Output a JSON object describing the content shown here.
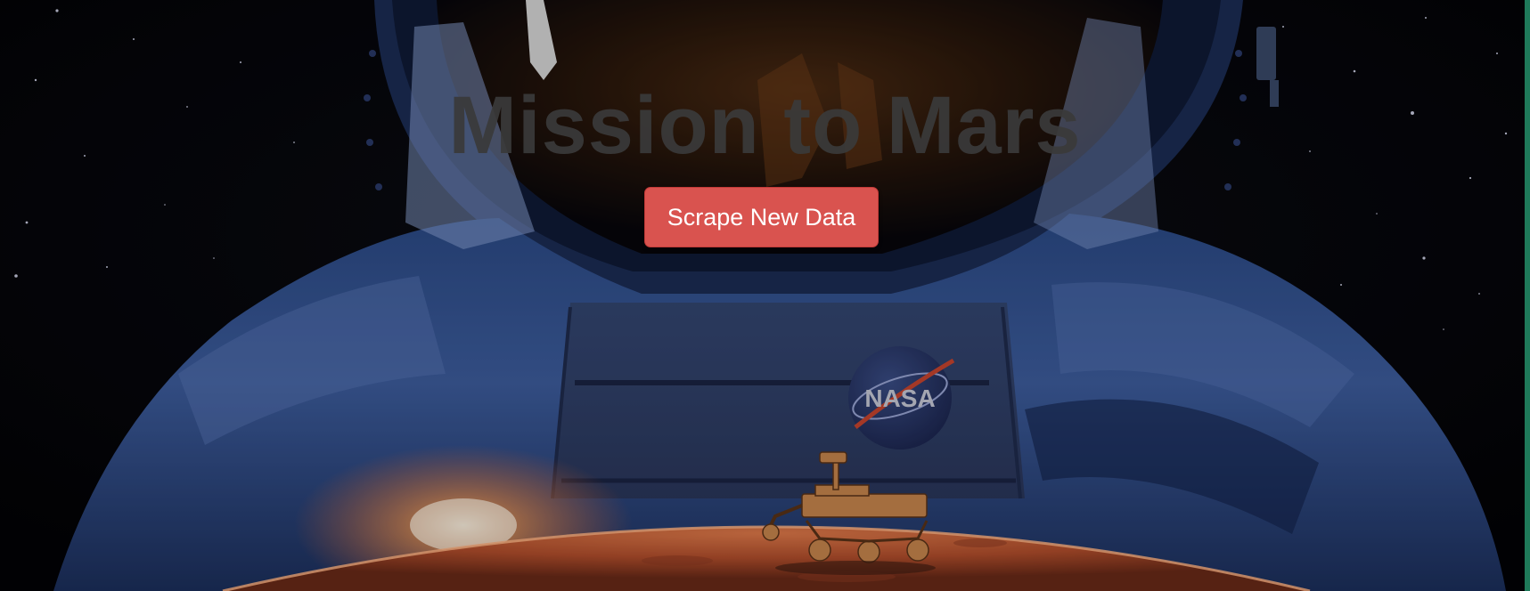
{
  "page": {
    "title": "Mission to Mars",
    "scrape_button_label": "Scrape New Data"
  },
  "hero": {
    "patch_text": "NASA",
    "image_subjects": [
      "starfield",
      "astronaut-suit",
      "nasa-patch",
      "mars-horizon",
      "rover"
    ]
  },
  "colors": {
    "button_bg": "#d9534f",
    "button_text": "#ffffff",
    "title_text": "#3a3a3a",
    "space": "#05060a",
    "suit_blue": "#3a5a9a",
    "mars_orange": "#d0643a"
  }
}
